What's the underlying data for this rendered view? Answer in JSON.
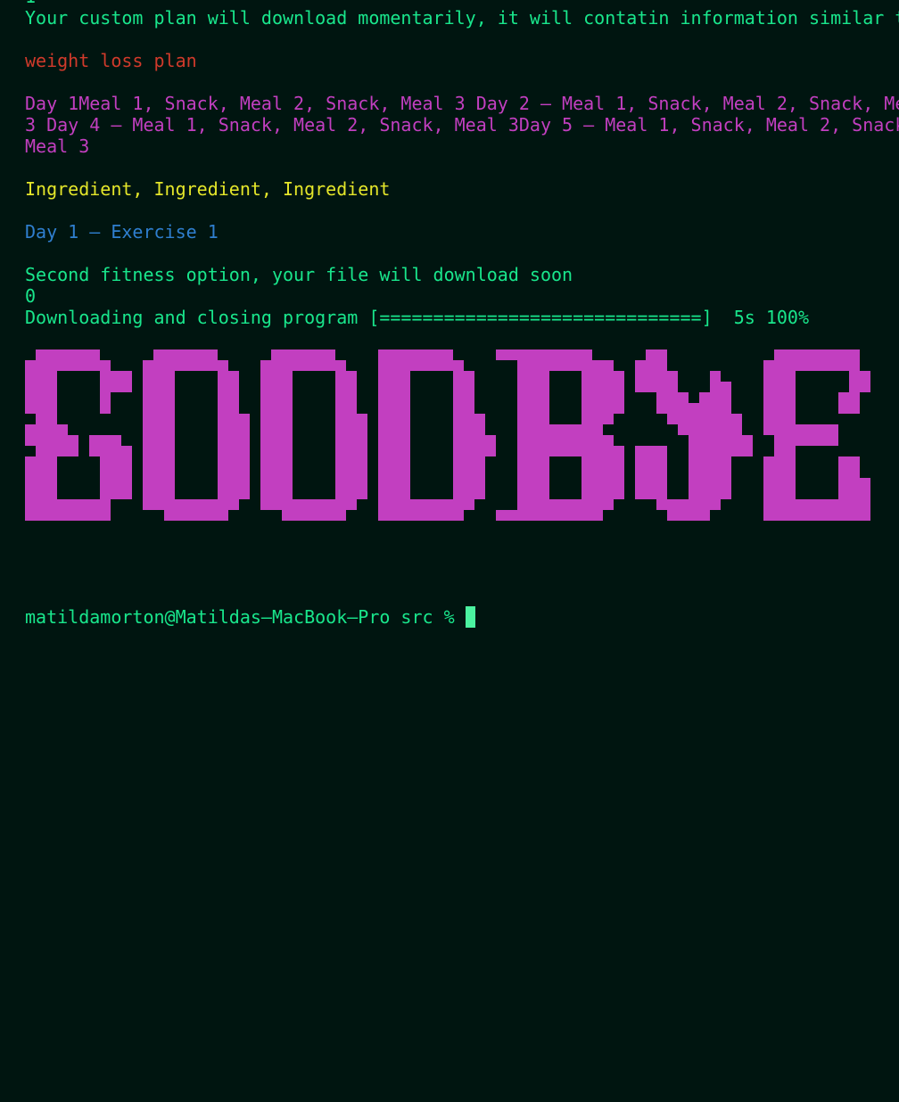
{
  "lines": {
    "previous_line_fragment": "1",
    "plan_intro": "Your custom plan will download momentarily, it will contatin information similar t",
    "plan_name": "weight loss plan",
    "meal_plan_line1": "Day 1Meal 1, Snack, Meal 2, Snack, Meal 3 Day 2 – Meal 1, Snack, Meal 2, Snack, Me",
    "meal_plan_line2": "3 Day 4 – Meal 1, Snack, Meal 2, Snack, Meal 3Day 5 – Meal 1, Snack, Meal 2, Snack",
    "meal_plan_line3": "Meal 3",
    "ingredients": "Ingredient, Ingredient, Ingredient",
    "exercise": "Day 1 – Exercise 1",
    "fitness_option": "Second fitness option, your file will download soon",
    "zero": "0",
    "download_status": "Downloading and closing program [==============================]  5s 100%"
  },
  "progress": {
    "percent": 100,
    "elapsed": "5s"
  },
  "banner": {
    "text": "GOODBYE",
    "color": "#c23fc0"
  },
  "prompt": {
    "text": "matildamorton@Matildas–MacBook–Pro src % "
  },
  "colors": {
    "background": "#001510",
    "green": "#19e68c",
    "red": "#d03a2b",
    "magenta": "#c23fc0",
    "yellow": "#e4e62a",
    "blue": "#2f7fcf",
    "cursor": "#4bf2a0"
  }
}
